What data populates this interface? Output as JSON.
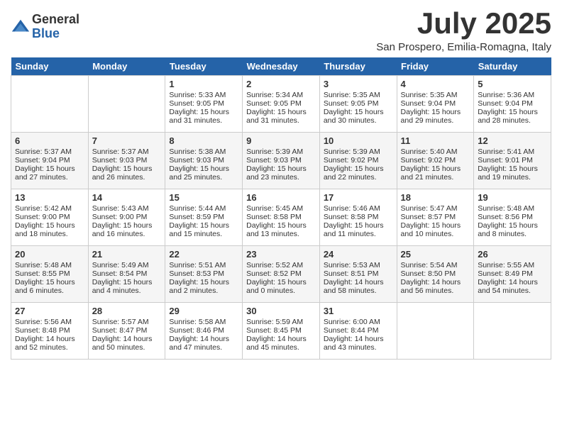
{
  "logo": {
    "general": "General",
    "blue": "Blue"
  },
  "title": {
    "month_year": "July 2025",
    "location": "San Prospero, Emilia-Romagna, Italy"
  },
  "headers": [
    "Sunday",
    "Monday",
    "Tuesday",
    "Wednesday",
    "Thursday",
    "Friday",
    "Saturday"
  ],
  "weeks": [
    [
      {
        "date": "",
        "sunrise": "",
        "sunset": "",
        "daylight": ""
      },
      {
        "date": "",
        "sunrise": "",
        "sunset": "",
        "daylight": ""
      },
      {
        "date": "1",
        "sunrise": "Sunrise: 5:33 AM",
        "sunset": "Sunset: 9:05 PM",
        "daylight": "Daylight: 15 hours and 31 minutes."
      },
      {
        "date": "2",
        "sunrise": "Sunrise: 5:34 AM",
        "sunset": "Sunset: 9:05 PM",
        "daylight": "Daylight: 15 hours and 31 minutes."
      },
      {
        "date": "3",
        "sunrise": "Sunrise: 5:35 AM",
        "sunset": "Sunset: 9:05 PM",
        "daylight": "Daylight: 15 hours and 30 minutes."
      },
      {
        "date": "4",
        "sunrise": "Sunrise: 5:35 AM",
        "sunset": "Sunset: 9:04 PM",
        "daylight": "Daylight: 15 hours and 29 minutes."
      },
      {
        "date": "5",
        "sunrise": "Sunrise: 5:36 AM",
        "sunset": "Sunset: 9:04 PM",
        "daylight": "Daylight: 15 hours and 28 minutes."
      }
    ],
    [
      {
        "date": "6",
        "sunrise": "Sunrise: 5:37 AM",
        "sunset": "Sunset: 9:04 PM",
        "daylight": "Daylight: 15 hours and 27 minutes."
      },
      {
        "date": "7",
        "sunrise": "Sunrise: 5:37 AM",
        "sunset": "Sunset: 9:03 PM",
        "daylight": "Daylight: 15 hours and 26 minutes."
      },
      {
        "date": "8",
        "sunrise": "Sunrise: 5:38 AM",
        "sunset": "Sunset: 9:03 PM",
        "daylight": "Daylight: 15 hours and 25 minutes."
      },
      {
        "date": "9",
        "sunrise": "Sunrise: 5:39 AM",
        "sunset": "Sunset: 9:03 PM",
        "daylight": "Daylight: 15 hours and 23 minutes."
      },
      {
        "date": "10",
        "sunrise": "Sunrise: 5:39 AM",
        "sunset": "Sunset: 9:02 PM",
        "daylight": "Daylight: 15 hours and 22 minutes."
      },
      {
        "date": "11",
        "sunrise": "Sunrise: 5:40 AM",
        "sunset": "Sunset: 9:02 PM",
        "daylight": "Daylight: 15 hours and 21 minutes."
      },
      {
        "date": "12",
        "sunrise": "Sunrise: 5:41 AM",
        "sunset": "Sunset: 9:01 PM",
        "daylight": "Daylight: 15 hours and 19 minutes."
      }
    ],
    [
      {
        "date": "13",
        "sunrise": "Sunrise: 5:42 AM",
        "sunset": "Sunset: 9:00 PM",
        "daylight": "Daylight: 15 hours and 18 minutes."
      },
      {
        "date": "14",
        "sunrise": "Sunrise: 5:43 AM",
        "sunset": "Sunset: 9:00 PM",
        "daylight": "Daylight: 15 hours and 16 minutes."
      },
      {
        "date": "15",
        "sunrise": "Sunrise: 5:44 AM",
        "sunset": "Sunset: 8:59 PM",
        "daylight": "Daylight: 15 hours and 15 minutes."
      },
      {
        "date": "16",
        "sunrise": "Sunrise: 5:45 AM",
        "sunset": "Sunset: 8:58 PM",
        "daylight": "Daylight: 15 hours and 13 minutes."
      },
      {
        "date": "17",
        "sunrise": "Sunrise: 5:46 AM",
        "sunset": "Sunset: 8:58 PM",
        "daylight": "Daylight: 15 hours and 11 minutes."
      },
      {
        "date": "18",
        "sunrise": "Sunrise: 5:47 AM",
        "sunset": "Sunset: 8:57 PM",
        "daylight": "Daylight: 15 hours and 10 minutes."
      },
      {
        "date": "19",
        "sunrise": "Sunrise: 5:48 AM",
        "sunset": "Sunset: 8:56 PM",
        "daylight": "Daylight: 15 hours and 8 minutes."
      }
    ],
    [
      {
        "date": "20",
        "sunrise": "Sunrise: 5:48 AM",
        "sunset": "Sunset: 8:55 PM",
        "daylight": "Daylight: 15 hours and 6 minutes."
      },
      {
        "date": "21",
        "sunrise": "Sunrise: 5:49 AM",
        "sunset": "Sunset: 8:54 PM",
        "daylight": "Daylight: 15 hours and 4 minutes."
      },
      {
        "date": "22",
        "sunrise": "Sunrise: 5:51 AM",
        "sunset": "Sunset: 8:53 PM",
        "daylight": "Daylight: 15 hours and 2 minutes."
      },
      {
        "date": "23",
        "sunrise": "Sunrise: 5:52 AM",
        "sunset": "Sunset: 8:52 PM",
        "daylight": "Daylight: 15 hours and 0 minutes."
      },
      {
        "date": "24",
        "sunrise": "Sunrise: 5:53 AM",
        "sunset": "Sunset: 8:51 PM",
        "daylight": "Daylight: 14 hours and 58 minutes."
      },
      {
        "date": "25",
        "sunrise": "Sunrise: 5:54 AM",
        "sunset": "Sunset: 8:50 PM",
        "daylight": "Daylight: 14 hours and 56 minutes."
      },
      {
        "date": "26",
        "sunrise": "Sunrise: 5:55 AM",
        "sunset": "Sunset: 8:49 PM",
        "daylight": "Daylight: 14 hours and 54 minutes."
      }
    ],
    [
      {
        "date": "27",
        "sunrise": "Sunrise: 5:56 AM",
        "sunset": "Sunset: 8:48 PM",
        "daylight": "Daylight: 14 hours and 52 minutes."
      },
      {
        "date": "28",
        "sunrise": "Sunrise: 5:57 AM",
        "sunset": "Sunset: 8:47 PM",
        "daylight": "Daylight: 14 hours and 50 minutes."
      },
      {
        "date": "29",
        "sunrise": "Sunrise: 5:58 AM",
        "sunset": "Sunset: 8:46 PM",
        "daylight": "Daylight: 14 hours and 47 minutes."
      },
      {
        "date": "30",
        "sunrise": "Sunrise: 5:59 AM",
        "sunset": "Sunset: 8:45 PM",
        "daylight": "Daylight: 14 hours and 45 minutes."
      },
      {
        "date": "31",
        "sunrise": "Sunrise: 6:00 AM",
        "sunset": "Sunset: 8:44 PM",
        "daylight": "Daylight: 14 hours and 43 minutes."
      },
      {
        "date": "",
        "sunrise": "",
        "sunset": "",
        "daylight": ""
      },
      {
        "date": "",
        "sunrise": "",
        "sunset": "",
        "daylight": ""
      }
    ]
  ]
}
